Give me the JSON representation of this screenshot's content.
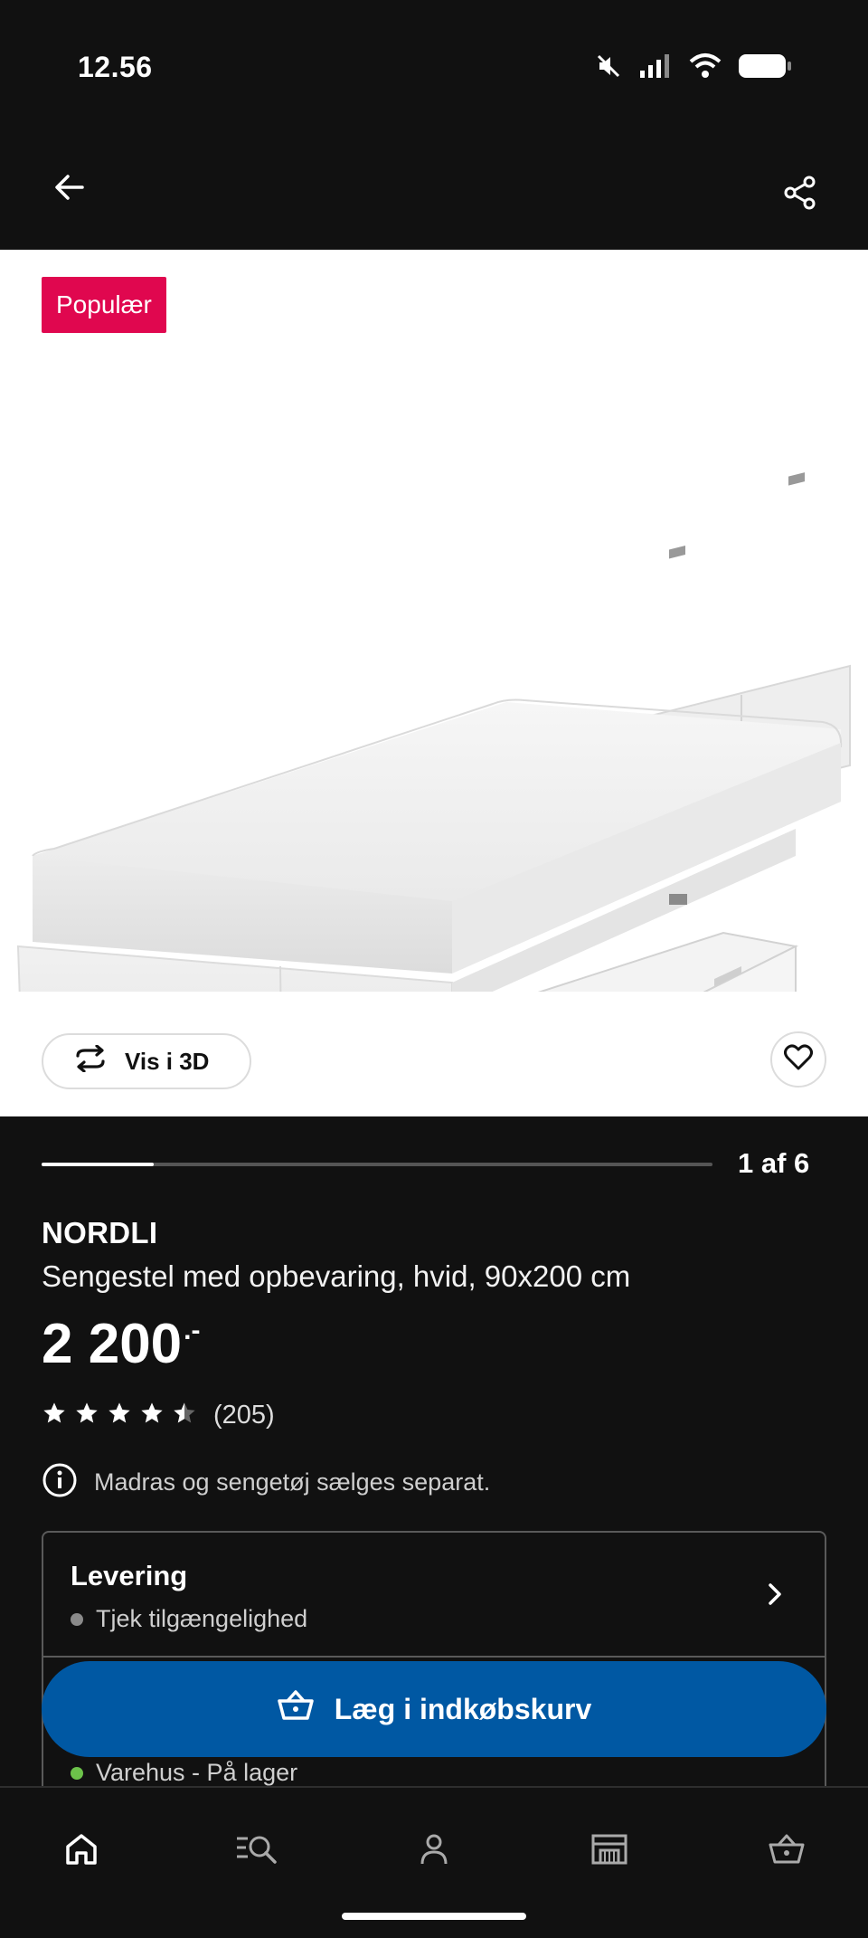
{
  "status_bar": {
    "time": "12.56"
  },
  "hero": {
    "badge": "Populær",
    "view_3d_label": "Vis i 3D"
  },
  "gallery": {
    "counter": "1 af 6",
    "current": 1,
    "total": 6
  },
  "product": {
    "name": "NORDLI",
    "description": "Sengestel med opbevaring, hvid, 90x200 cm",
    "price": "2 200",
    "price_suffix": ".-",
    "rating": 4.5,
    "rating_count": "(205)",
    "note": "Madras og sengetøj sælges separat."
  },
  "delivery": {
    "title": "Levering",
    "status": "Tjek tilgængelighed",
    "status_color": "#8a8a8a",
    "store_status": "Varehus - På lager",
    "store_status_color": "#6cc24a"
  },
  "cart_button": {
    "label": "Læg i indkøbskurv",
    "color": "#0058a3"
  },
  "bottom_nav": {
    "items": [
      {
        "icon": "home-icon"
      },
      {
        "icon": "search-icon"
      },
      {
        "icon": "profile-icon"
      },
      {
        "icon": "store-icon"
      },
      {
        "icon": "basket-icon"
      }
    ]
  },
  "colors": {
    "badge": "#e0074f",
    "background": "#111111"
  }
}
